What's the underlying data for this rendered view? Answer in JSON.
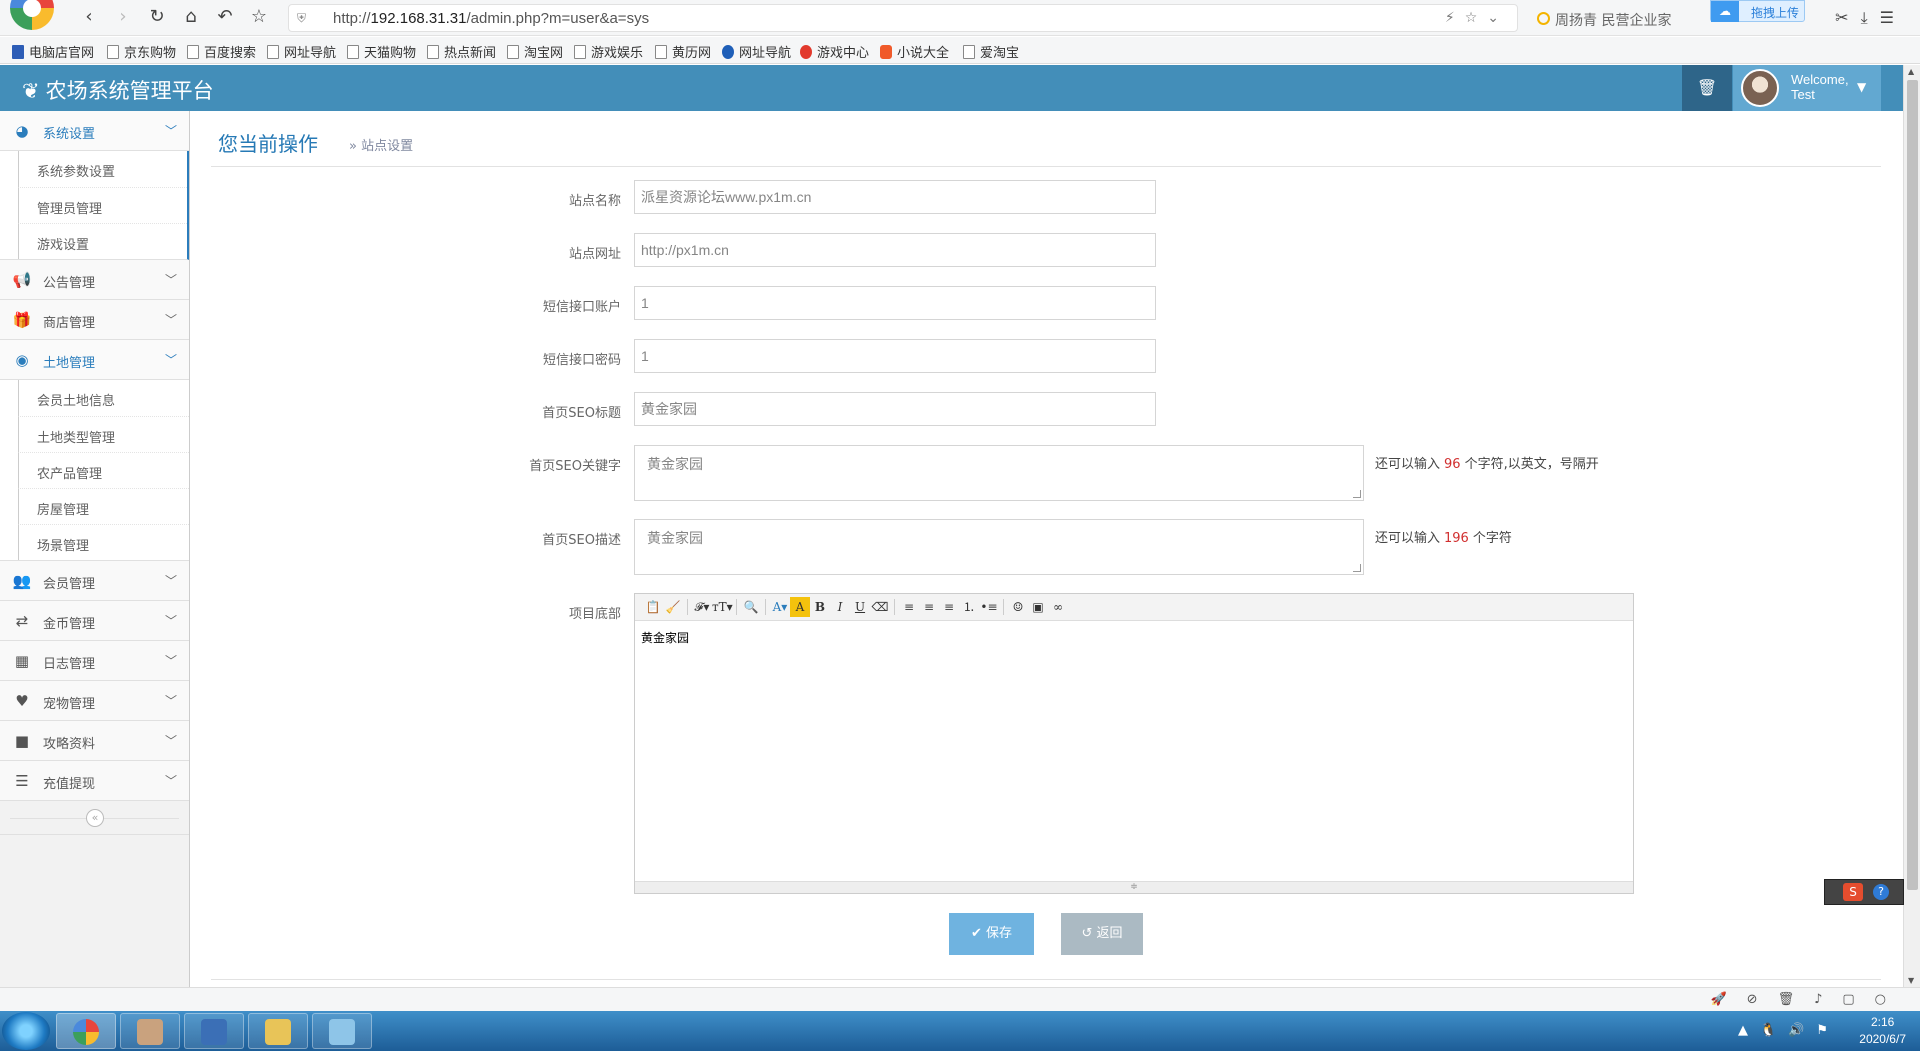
{
  "browser": {
    "url_prefix": "http://",
    "url_host": "192.168.31.31",
    "url_path": "/admin.php?m=user&a=sys",
    "search_text": "周扬青 民营企业家",
    "upload_label": "拖拽上传",
    "bookmarks": [
      "电脑店官网",
      "京东购物",
      "百度搜索",
      "网址导航",
      "天猫购物",
      "热点新闻",
      "淘宝网",
      "游戏娱乐",
      "黄历网",
      "网址导航",
      "游戏中心",
      "小说大全",
      "爱淘宝"
    ]
  },
  "header": {
    "title": "农场系统管理平台",
    "welcome": "Welcome,",
    "user": "Test"
  },
  "sidebar": {
    "groups": [
      {
        "label": "系统设置",
        "icon": "dashboard-icon",
        "items": [
          "系统参数设置",
          "管理员管理",
          "游戏设置"
        ]
      },
      {
        "label": "公告管理",
        "icon": "bullhorn-icon"
      },
      {
        "label": "商店管理",
        "icon": "gift-icon"
      },
      {
        "label": "土地管理",
        "icon": "globe-icon",
        "items": [
          "会员土地信息",
          "土地类型管理",
          "农产品管理",
          "房屋管理",
          "场景管理"
        ]
      },
      {
        "label": "会员管理",
        "icon": "users-icon"
      },
      {
        "label": "金币管理",
        "icon": "exchange-icon"
      },
      {
        "label": "日志管理",
        "icon": "calendar-icon"
      },
      {
        "label": "宠物管理",
        "icon": "heart-icon"
      },
      {
        "label": "攻略资料",
        "icon": "folder-icon"
      },
      {
        "label": "充值提现",
        "icon": "list-icon"
      }
    ]
  },
  "breadcrumb": {
    "title": "您当前操作",
    "sub": "» 站点设置"
  },
  "form": {
    "site_name": {
      "label": "站点名称",
      "value": "派星资源论坛www.px1m.cn"
    },
    "site_url": {
      "label": "站点网址",
      "value": "http://px1m.cn"
    },
    "sms_account": {
      "label": "短信接口账户",
      "value": "1"
    },
    "sms_password": {
      "label": "短信接口密码",
      "value": "1"
    },
    "seo_title": {
      "label": "首页SEO标题",
      "value": "黄金家园"
    },
    "seo_keywords": {
      "label": "首页SEO关键字",
      "value": "黄金家园",
      "hint_prefix": "还可以输入",
      "hint_count": "96",
      "hint_suffix": "个字符,以英文，号隔开"
    },
    "seo_description": {
      "label": "首页SEO描述",
      "value": "黄金家园",
      "hint_prefix": "还可以输入",
      "hint_count": "196",
      "hint_suffix": "个字符"
    },
    "footer": {
      "label": "项目底部",
      "content": "黄金家园"
    },
    "save_label": "保存",
    "back_label": "返回"
  },
  "taskbar": {
    "time": "2:16",
    "date": "2020/6/7"
  }
}
